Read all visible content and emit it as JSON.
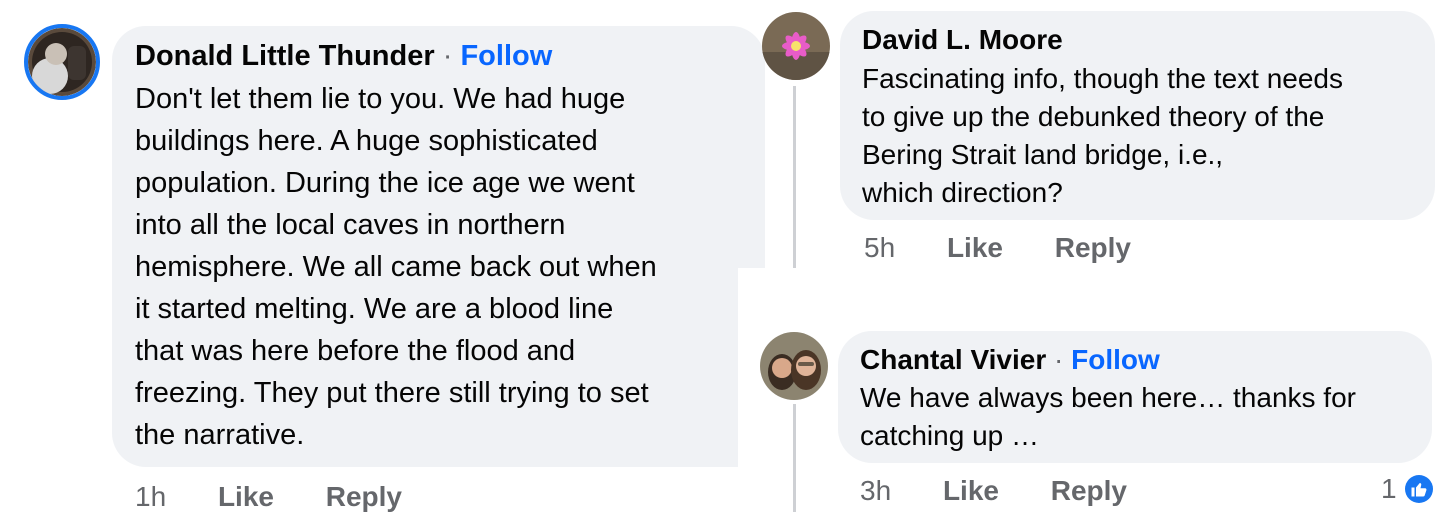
{
  "comments": [
    {
      "author": "Donald Little Thunder",
      "separator": "·",
      "follow": "Follow",
      "lines": [
        "Don't let them lie to you. We had huge",
        "buildings here. A huge sophisticated",
        "population. During the ice age we went",
        "into all the local caves in northern",
        "hemisphere. We all came back out when",
        "it started melting. We are a blood line",
        "that was here before the flood and",
        "freezing. They put there still trying to set",
        "the narrative."
      ],
      "time": "1h",
      "like": "Like",
      "reply": "Reply"
    },
    {
      "author": "David L. Moore",
      "lines": [
        "Fascinating info, though the text needs",
        "to give up the debunked theory of the",
        "Bering Strait land bridge, i.e.,",
        "which direction?"
      ],
      "time": "5h",
      "like": "Like",
      "reply": "Reply"
    },
    {
      "author": "Chantal Vivier",
      "separator": "·",
      "follow": "Follow",
      "lines": [
        "We have always been here… thanks for",
        "catching up …"
      ],
      "time": "3h",
      "like": "Like",
      "reply": "Reply",
      "reaction_count": "1",
      "reaction_icon": "like-thumb-icon"
    }
  ],
  "colors": {
    "bubble": "#f0f2f5",
    "follow": "#0866ff",
    "meta": "#65676b",
    "like_badge": "#1877f2",
    "avatar_ring": "#1877f2"
  }
}
